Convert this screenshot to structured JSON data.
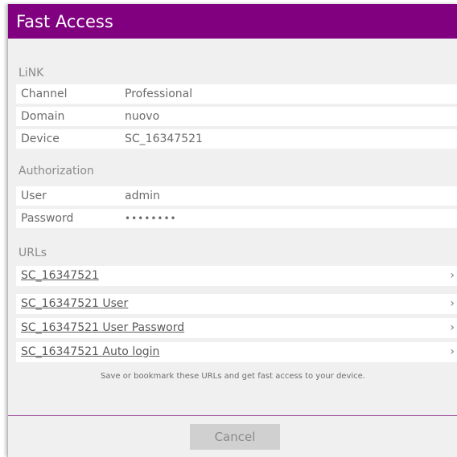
{
  "dialog": {
    "title": "Fast Access",
    "link": {
      "heading": "LiNK",
      "rows": [
        {
          "label": "Channel",
          "value": "Professional"
        },
        {
          "label": "Domain",
          "value": "nuovo"
        },
        {
          "label": "Device",
          "value": "SC_16347521"
        }
      ]
    },
    "authorization": {
      "heading": "Authorization",
      "rows": [
        {
          "label": "User",
          "value": "admin"
        },
        {
          "label": "Password",
          "value": "••••••••"
        }
      ]
    },
    "urls": {
      "heading": "URLs",
      "items": [
        {
          "label": "SC_16347521"
        },
        {
          "label": "SC_16347521 User"
        },
        {
          "label": "SC_16347521 User Password"
        },
        {
          "label": "SC_16347521 Auto login"
        }
      ],
      "chevron": "›"
    },
    "note": "Save or bookmark these URLs and get fast access to your device.",
    "cancel_label": "Cancel",
    "colors": {
      "titlebar": "#800080",
      "background": "#f0f0f0"
    }
  }
}
